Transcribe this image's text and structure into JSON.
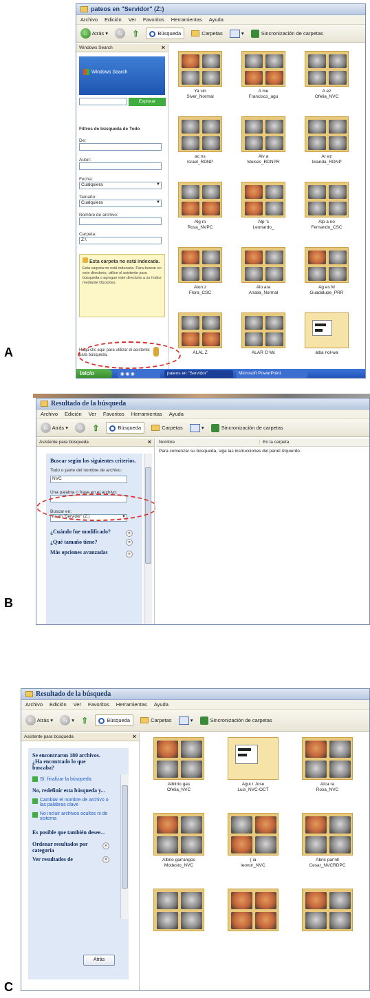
{
  "panels": {
    "a": {
      "letter": "A",
      "title": "pateos en \"Servidor\" (Z:)",
      "menu": [
        "Archivo",
        "Edición",
        "Ver",
        "Favoritos",
        "Herramientas",
        "Ayuda"
      ],
      "toolbar": {
        "back": "Atrás",
        "search": "Búsqueda",
        "folders": "Carpetas",
        "sync": "Sincronización de carpetas"
      },
      "sidebar": {
        "header": "Windows Search",
        "brand": "Windows Search",
        "search_button": "Explorar",
        "filters_title": "Filtros de búsqueda de Todo",
        "de_label": "De:",
        "autor_label": "Autor:",
        "fecha_label": "Fecha:",
        "fecha_value": "Cualquiera",
        "tamano_label": "Tamaño:",
        "tamano_value": "Cualquiera",
        "nombre_label": "Nombre de archivo:",
        "carpeta_label": "Carpeta:",
        "carpeta_value": "Z:\\",
        "notice_title": "Esta carpeta no está indexada.",
        "notice_body": "Esta carpeta no está indexada. Para buscar en este directorio, utilice el asistente para búsqueda o agregue este directorio a su índice mediante Opciones.",
        "bottom_hint": "Haga clic aquí para utilizar el asistente para búsqueda."
      },
      "thumbs": [
        {
          "caption": "Ya     sin\nSiver_Normal"
        },
        {
          "caption": "A      me\nFrancisco_agu"
        },
        {
          "caption": "A      ez\nOfelia_NVC"
        },
        {
          "caption": "ac     ns\nIsrael_RDNP"
        },
        {
          "caption": "Alv      a\nMoises_RDNPR"
        },
        {
          "caption": "Ar      ez\nIolanda_RDNP"
        },
        {
          "caption": "Alg      ro\nRosa_NVPC"
        },
        {
          "caption": "Alp      's\nLeonardo_"
        },
        {
          "caption": "Alp      a no\nFernando_CSC"
        },
        {
          "caption": "Alon     z\nFlora_CSC"
        },
        {
          "caption": "Alo     ara\nAnalia_Normal"
        },
        {
          "caption": "Ag     es M\nGuadalupe_PRR"
        },
        {
          "caption": "ALAL      Z\n"
        },
        {
          "caption": "ALAR     O Mc\n"
        },
        {
          "caption": "alba      nol-wa\n"
        }
      ],
      "taskbar": {
        "start": "Inicio",
        "task1": "pateos en \"Servidor\"",
        "task2": "Microsoft PowerPoint"
      }
    },
    "b": {
      "letter": "B",
      "title": "Resultado de la búsqueda",
      "menu": [
        "Archivo",
        "Edición",
        "Ver",
        "Favoritos",
        "Herramientas",
        "Ayuda"
      ],
      "toolbar": {
        "back": "Atrás",
        "search": "Búsqueda",
        "folders": "Carpetas",
        "sync": "Sincronización de carpetas"
      },
      "sidebar": {
        "header": "Asistente para búsqueda",
        "criteria_title": "Buscar según los siguientes criterios.",
        "name_label": "Todo o parte del nombre de archivo:",
        "name_value": "NVC",
        "phrase_label": "Una palabra o frase en el archivo:",
        "look_in_label": "Buscar en:",
        "look_in_value": "na en \"Servidor\" (Z:)",
        "when_label": "¿Cuándo fue modificado?",
        "size_label": "¿Qué tamaño tiene?",
        "more_label": "Más opciones avanzadas"
      },
      "columns": {
        "name": "Nombre",
        "folder": "En la carpeta"
      },
      "instruction": "Para comenzar su búsqueda, siga las instrucciones del panel izquierdo."
    },
    "c": {
      "letter": "C",
      "title": "Resultado de la búsqueda",
      "menu": [
        "Archivo",
        "Edición",
        "Ver",
        "Favoritos",
        "Herramientas",
        "Ayuda"
      ],
      "toolbar": {
        "back": "Atrás",
        "search": "Búsqueda",
        "folders": "Carpetas",
        "sync": "Sincronización de carpetas"
      },
      "sidebar": {
        "header": "Asistente para búsqueda",
        "found_title": "Se encontraron 180 archivos. ¿Ha encontrado lo que buscaba?",
        "finish": "Sí, finalizar la búsqueda",
        "refine_title": "No, redefinir esta búsqueda y...",
        "change_name": "Cambiar el nombre de archivo o las palabras clave",
        "exclude": "No incluir archivos ocultos ni de sistema",
        "possible": "Es posible que también desee...",
        "sort": "Ordenar resultados por categoría",
        "view_more": "Ver resultados de",
        "back_button": "Atrás"
      },
      "thumbs": [
        {
          "caption": "Albitrio gas\nOfelia_NVC"
        },
        {
          "caption": "Agui      r Jose\nLuis_NVC-OCT"
        },
        {
          "caption": "Alca       ra\nRosa_NVC"
        },
        {
          "caption": "Albrio garrangos\nModesto_NVC"
        },
        {
          "caption": "(        ia\nleonor_NVC"
        },
        {
          "caption": "Abric par'nll\nCesar_NVCRDPC"
        },
        {
          "caption": ""
        },
        {
          "caption": ""
        },
        {
          "caption": ""
        }
      ]
    }
  },
  "colors": {
    "fundus_orange": "#c3653b",
    "fundus_gray": "#8c8c8c",
    "folder_yellow": "#e8c87a",
    "highlight_red": "#d9302c",
    "xp_blue": "#2d59b8"
  }
}
